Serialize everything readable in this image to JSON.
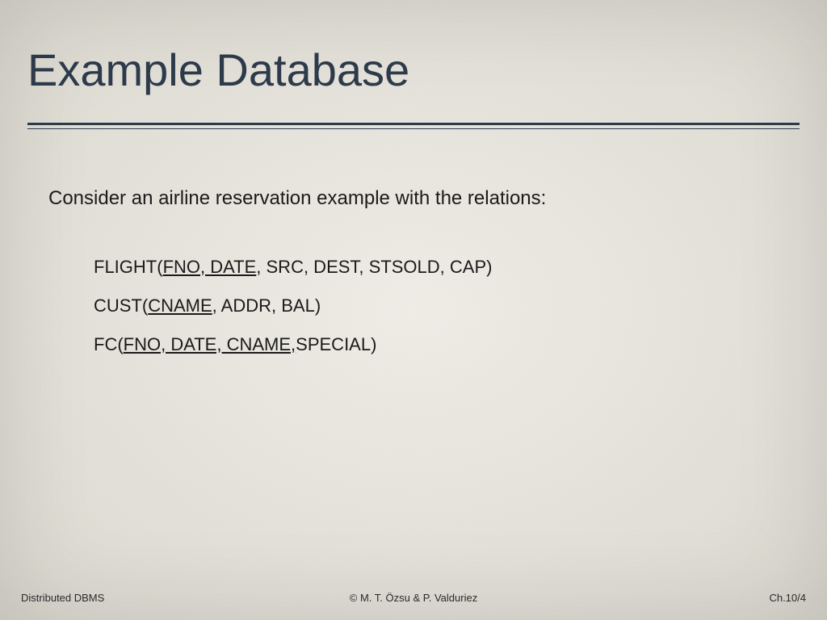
{
  "title": "Example Database",
  "intro": "Consider an airline reservation example with the relations:",
  "relations": {
    "flight": {
      "name": "FLIGHT",
      "key": "FNO, DATE",
      "rest": ", SRC, DEST, STSOLD, CAP)"
    },
    "cust": {
      "name": "CUST",
      "key": "CNAME",
      "rest": ", ADDR, BAL)"
    },
    "fc": {
      "name": "FC",
      "key": "FNO, DATE, CNAME,",
      "rest": "SPECIAL)"
    }
  },
  "footer": {
    "left": "Distributed DBMS",
    "center": "© M. T. Özsu & P. Valduriez",
    "right": "Ch.10/4"
  }
}
